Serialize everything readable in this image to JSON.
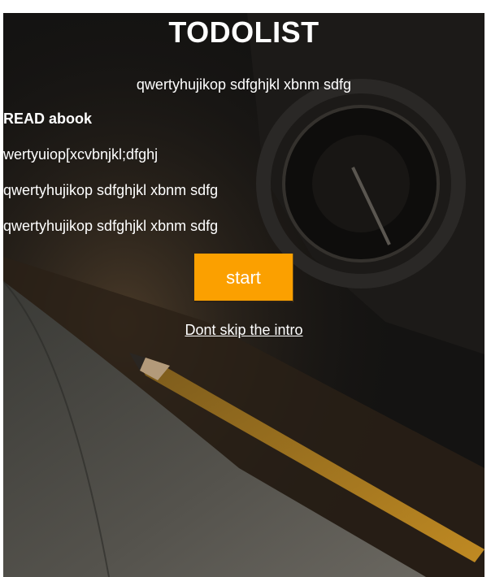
{
  "header": {
    "title": "TODOLIST",
    "subtitle": "qwertyhujikop sdfghjkl xbnm sdfg"
  },
  "todos": [
    {
      "text": "READ abook"
    },
    {
      "text": "wertyuiop[xcvbnjkl;dfghj"
    },
    {
      "text": "qwertyhujikop sdfghjkl xbnm sdfg"
    },
    {
      "text": "qwertyhujikop sdfghjkl xbnm sdfg"
    }
  ],
  "actions": {
    "start_label": "start",
    "intro_link_label": "Dont skip the intro"
  },
  "colors": {
    "accent": "#fba000",
    "background": "#141312",
    "text": "#ffffff"
  }
}
